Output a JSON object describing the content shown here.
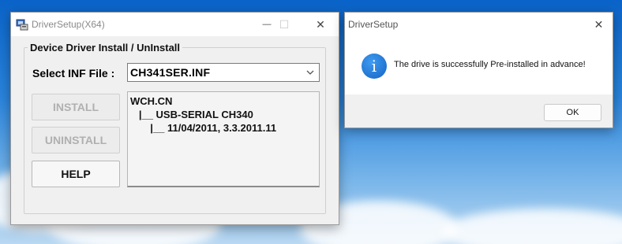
{
  "main_window": {
    "title": "DriverSetup(X64)",
    "minimize_glyph": "—",
    "maximize_glyph": "☐",
    "close_glyph": "✕",
    "group_title": "Device Driver Install / UnInstall",
    "inf_label": "Select INF File :",
    "inf_value": "CH341SER.INF",
    "buttons": {
      "install": "INSTALL",
      "uninstall": "UNINSTALL",
      "help": "HELP"
    },
    "info_lines": [
      "WCH.CN",
      "   |__ USB-SERIAL CH340",
      "       |__ 11/04/2011, 3.3.2011.11"
    ]
  },
  "dialog": {
    "title": "DriverSetup",
    "close_glyph": "✕",
    "icon_glyph": "i",
    "message": "The drive is successfully Pre-installed in advance!",
    "ok_label": "OK"
  },
  "colors": {
    "info_icon": "#1a73d6",
    "desktop_blue": "#1e78d6"
  }
}
